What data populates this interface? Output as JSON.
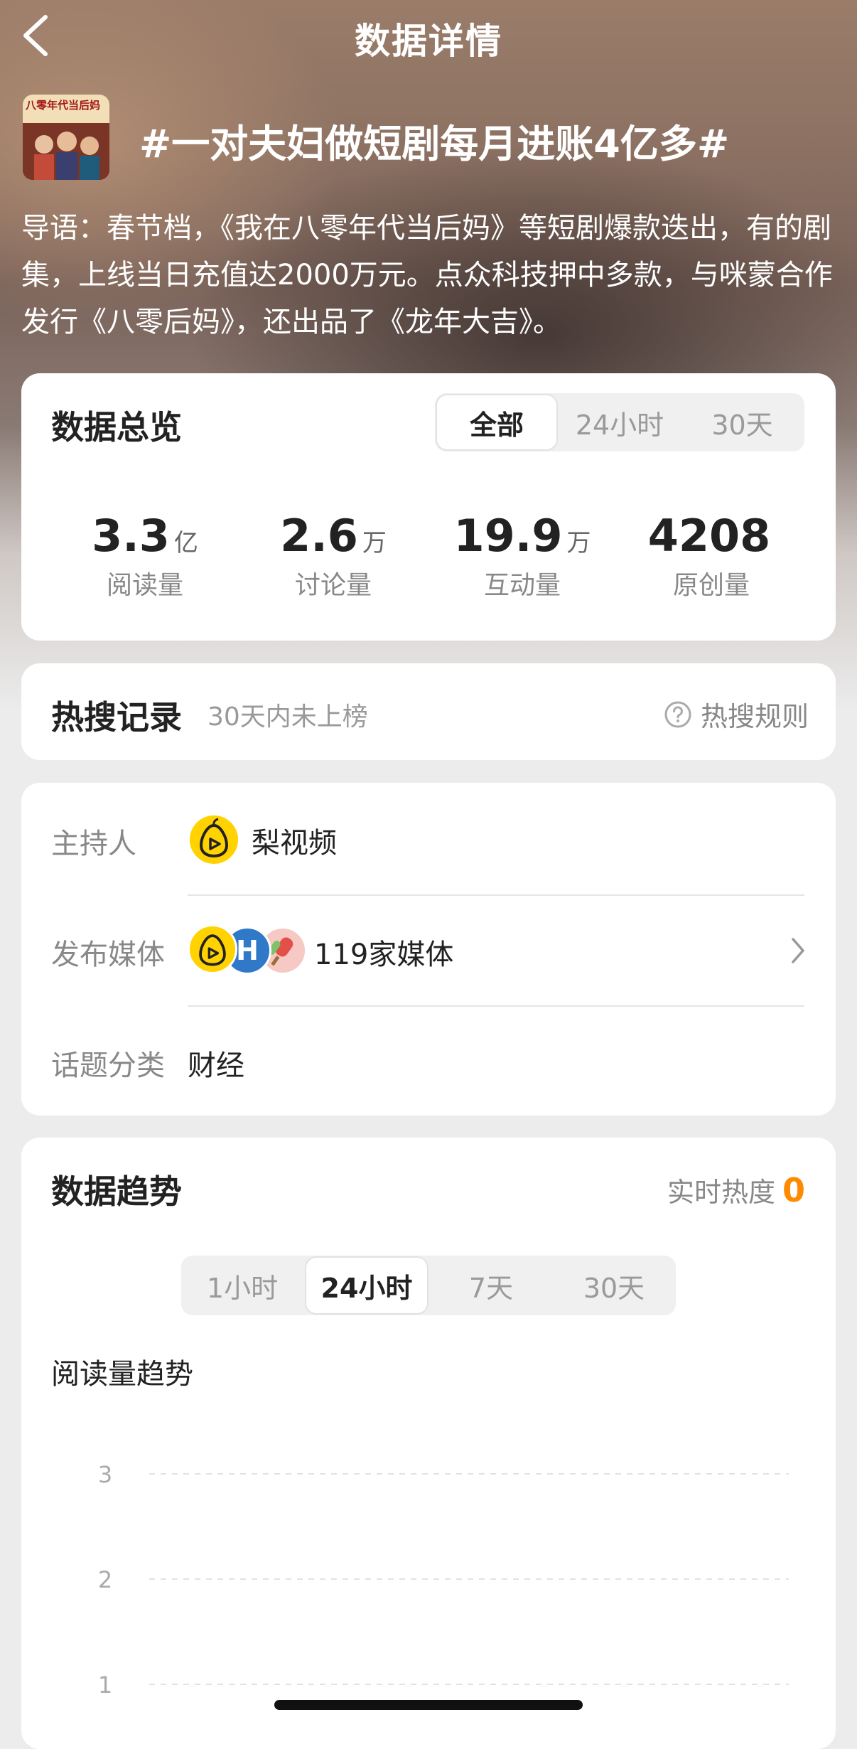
{
  "header": {
    "title": "数据详情"
  },
  "topic": {
    "title": "#一对夫妇做短剧每月进账4亿多#",
    "lead": "导语：春节档，《我在八零年代当后妈》等短剧爆款迭出，有的剧集，上线当日充值达2000万元。点众科技押中多款，与咪蒙合作发行《八零后妈》，还出品了《龙年大吉》。",
    "thumb_text": "八零年代当后妈"
  },
  "overview": {
    "title": "数据总览",
    "tabs": [
      "全部",
      "24小时",
      "30天"
    ],
    "active_tab": "全部",
    "stats": [
      {
        "value": "3.3",
        "unit": "亿",
        "label": "阅读量"
      },
      {
        "value": "2.6",
        "unit": "万",
        "label": "讨论量"
      },
      {
        "value": "19.9",
        "unit": "万",
        "label": "互动量"
      },
      {
        "value": "4208",
        "unit": "",
        "label": "原创量"
      }
    ]
  },
  "hot_search": {
    "title": "热搜记录",
    "subtitle": "30天内未上榜",
    "rules_label": "热搜规则"
  },
  "info": {
    "host_label": "主持人",
    "host_name": "梨视频",
    "media_label": "发布媒体",
    "media_count": "119家媒体",
    "category_label": "话题分类",
    "category_value": "财经"
  },
  "trend": {
    "title": "数据趋势",
    "realtime_label": "实时热度",
    "realtime_value": "0",
    "tabs": [
      "1小时",
      "24小时",
      "7天",
      "30天"
    ],
    "active_tab": "24小时",
    "chart_title": "阅读量趋势"
  },
  "chart_data": {
    "type": "line",
    "title": "阅读量趋势",
    "y_ticks": [
      "3",
      "2",
      "1"
    ],
    "grid": true,
    "series": []
  },
  "colors": {
    "accent_orange": "#ff8a00",
    "pear_yellow": "#ffd200"
  }
}
